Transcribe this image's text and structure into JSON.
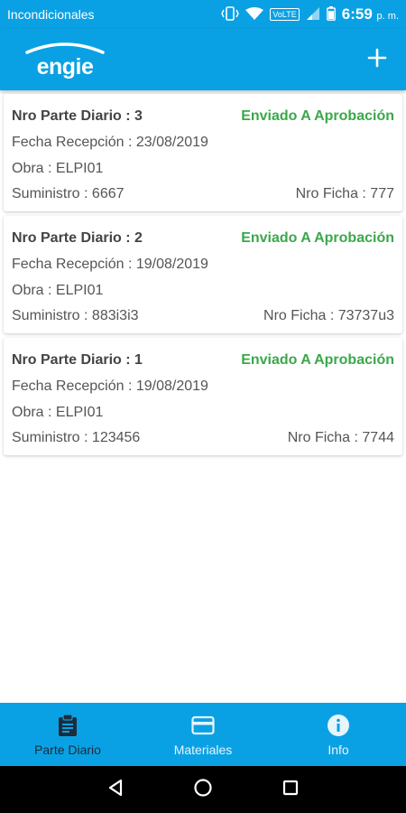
{
  "status_bar": {
    "carrier": "Incondicionales",
    "volte": "VoLTE",
    "time": "6:59",
    "ampm": "p. m."
  },
  "app_bar": {
    "logo_text": "engie",
    "add_icon": "plus-icon"
  },
  "records": [
    {
      "parte_label": "Nro Parte Diario : 3",
      "status": "Enviado A Aprobación",
      "fecha": "Fecha Recepción : 23/08/2019",
      "obra": "Obra : ELPI01",
      "suministro": "Suministro : 6667",
      "ficha": "Nro Ficha : 777"
    },
    {
      "parte_label": "Nro Parte Diario : 2",
      "status": "Enviado A Aprobación",
      "fecha": "Fecha Recepción : 19/08/2019",
      "obra": "Obra : ELPI01",
      "suministro": "Suministro : 883i3i3",
      "ficha": "Nro Ficha : 73737u3"
    },
    {
      "parte_label": "Nro Parte Diario : 1",
      "status": "Enviado A Aprobación",
      "fecha": "Fecha Recepción : 19/08/2019",
      "obra": "Obra : ELPI01",
      "suministro": "Suministro : 123456",
      "ficha": "Nro Ficha : 7744"
    }
  ],
  "bottom_nav": [
    {
      "label": "Parte Diario",
      "icon": "clipboard-icon",
      "active": true
    },
    {
      "label": "Materiales",
      "icon": "credit-card-icon",
      "active": false
    },
    {
      "label": "Info",
      "icon": "info-icon",
      "active": false
    }
  ],
  "colors": {
    "primary": "#0aa1e4",
    "status_green": "#3ba84a",
    "active_nav": "#1c2c3a"
  }
}
